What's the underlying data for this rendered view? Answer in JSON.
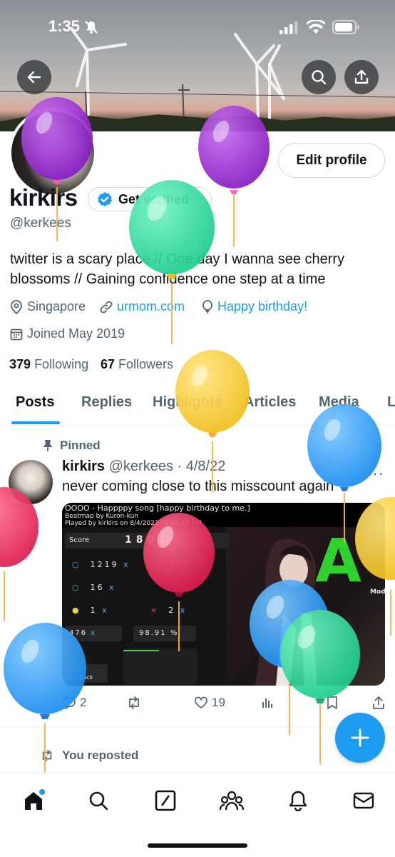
{
  "status_bar": {
    "time": "1:35"
  },
  "profile": {
    "name": "kirkirs",
    "get_verified_label": "Get verified",
    "handle": "@kerkees",
    "edit_profile_label": "Edit profile",
    "bio": "twitter is a scary place // One day I wanna see cherry blossoms // Gaining confidence one step at a time",
    "location": "Singapore",
    "website": "urmom.com",
    "birthday": "Happy birthday!",
    "joined": "Joined May 2019",
    "following_count": "379",
    "following_label": "Following",
    "followers_count": "67",
    "followers_label": "Followers"
  },
  "tabs": [
    "Posts",
    "Replies",
    "Highlights",
    "Articles",
    "Media",
    "L"
  ],
  "active_tab": "Posts",
  "pinned_post": {
    "pinned_label": "Pinned",
    "author": "kirkirs",
    "handle_date": "@kerkees · 4/8/22",
    "text": "never coming close to this misscount again",
    "media": {
      "title": "OOOO - Happppy song [happy birthday to me.]",
      "beatmap": "Beatmap by Kuron-kun",
      "played_by": "Played by kirkirs on 8/4/2022 12:44:28 AM",
      "score_label": "Score",
      "score": "1801",
      "row1_left": "1219",
      "row1_right": "271",
      "row2_left": "16",
      "row3_left": "1",
      "row3_right": "2",
      "combo": "476",
      "accuracy": "98.91",
      "grade": "A",
      "mods_label": "Mods",
      "back_label": "Back"
    },
    "replies": "2",
    "likes": "19"
  },
  "reposted_label": "You reposted",
  "colors": {
    "accent": "#1d9bf0",
    "text": "#0f1419",
    "muted": "#536471"
  }
}
